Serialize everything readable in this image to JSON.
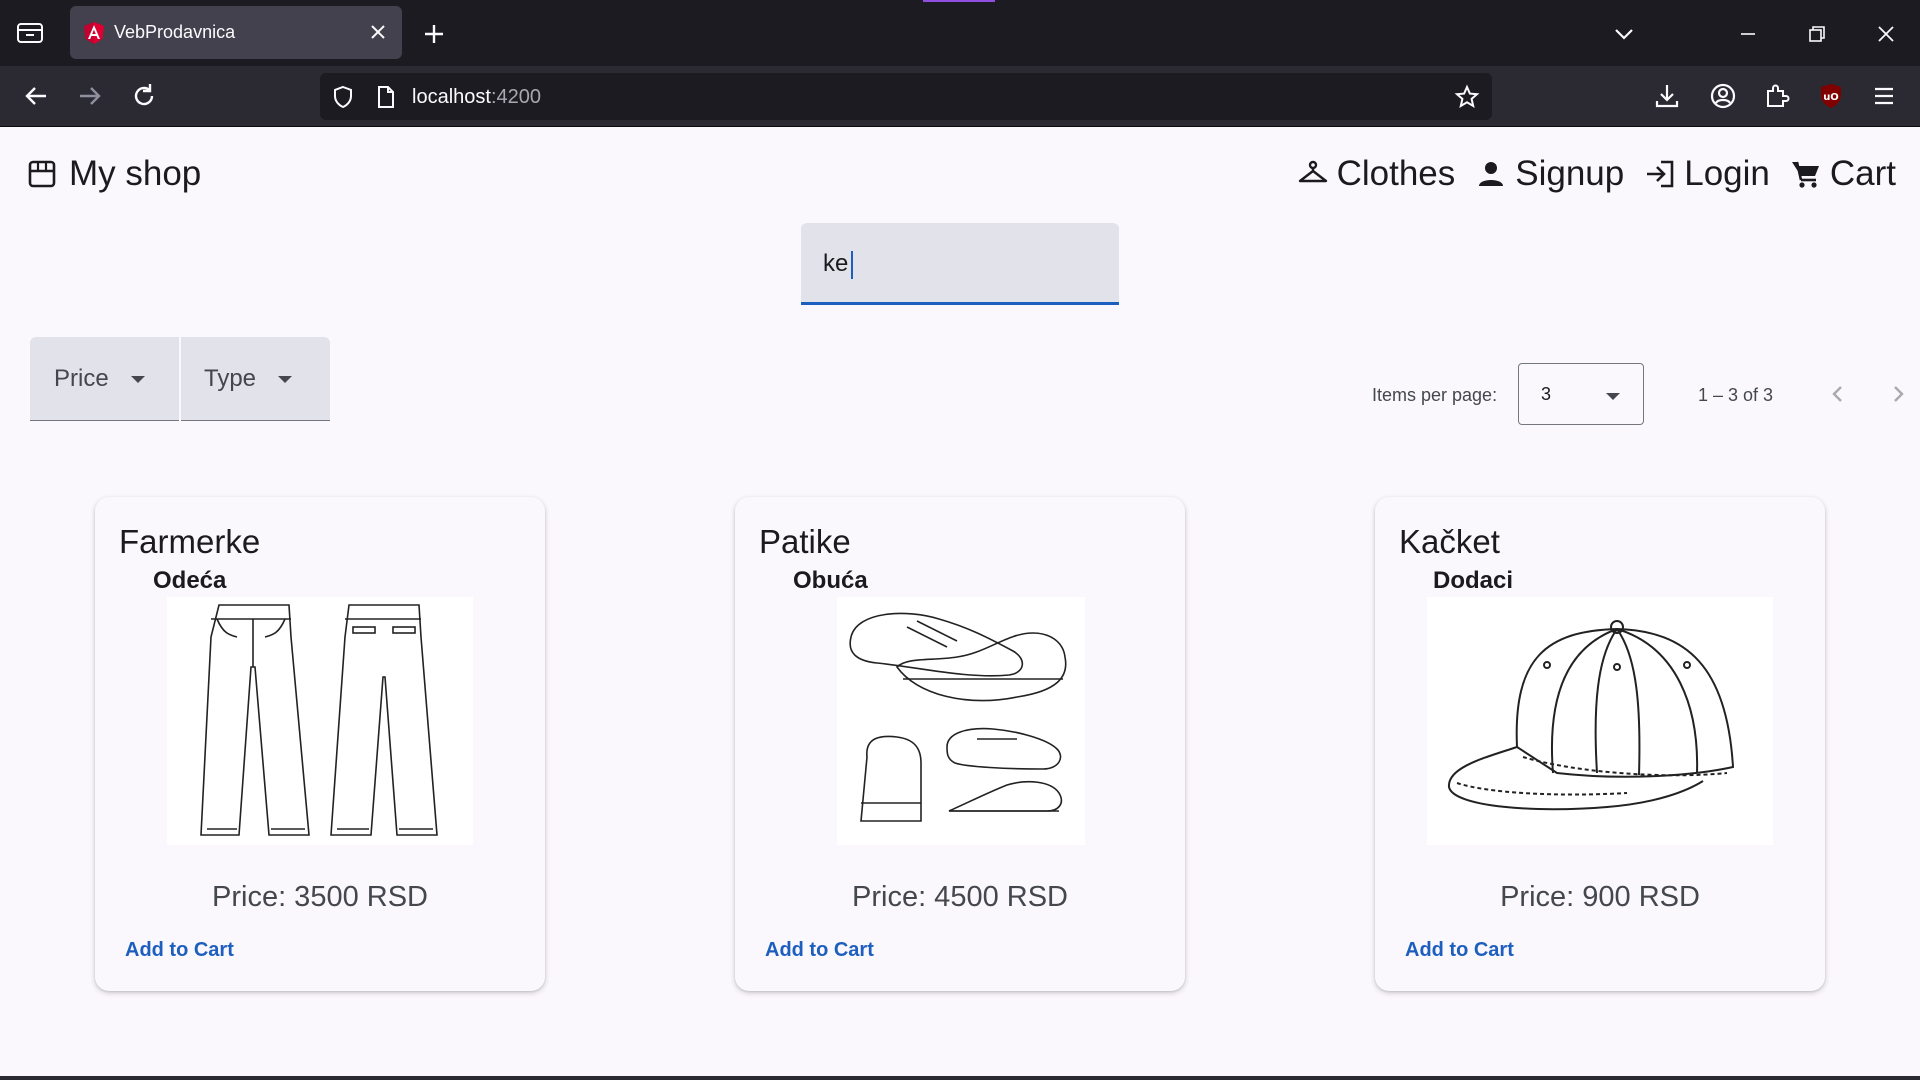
{
  "browser": {
    "tab_title": "VebProdavnica",
    "url_host": "localhost",
    "url_port": ":4200"
  },
  "header": {
    "brand": "My shop",
    "nav": [
      {
        "label": "Clothes",
        "icon": "hanger-icon"
      },
      {
        "label": "Signup",
        "icon": "person-icon"
      },
      {
        "label": "Login",
        "icon": "login-icon"
      },
      {
        "label": "Cart",
        "icon": "cart-icon"
      }
    ]
  },
  "search": {
    "value": "ke"
  },
  "filters": {
    "price_label": "Price",
    "type_label": "Type"
  },
  "paginator": {
    "items_per_page_label": "Items per page:",
    "items_per_page_value": "3",
    "range_label": "1 – 3 of 3"
  },
  "products": [
    {
      "name": "Farmerke",
      "type": "Odeća",
      "price": "Price: 3500 RSD",
      "add_label": "Add to Cart",
      "image": "jeans-drawing"
    },
    {
      "name": "Patike",
      "type": "Obuća",
      "price": "Price: 4500 RSD",
      "add_label": "Add to Cart",
      "image": "sneakers-drawing"
    },
    {
      "name": "Kačket",
      "type": "Dodaci",
      "price": "Price: 900 RSD",
      "add_label": "Add to Cart",
      "image": "cap-drawing"
    }
  ],
  "colors": {
    "accent": "#1d5fbf",
    "chrome_dark": "#1c1b22",
    "page_bg": "#fbf8fd"
  }
}
